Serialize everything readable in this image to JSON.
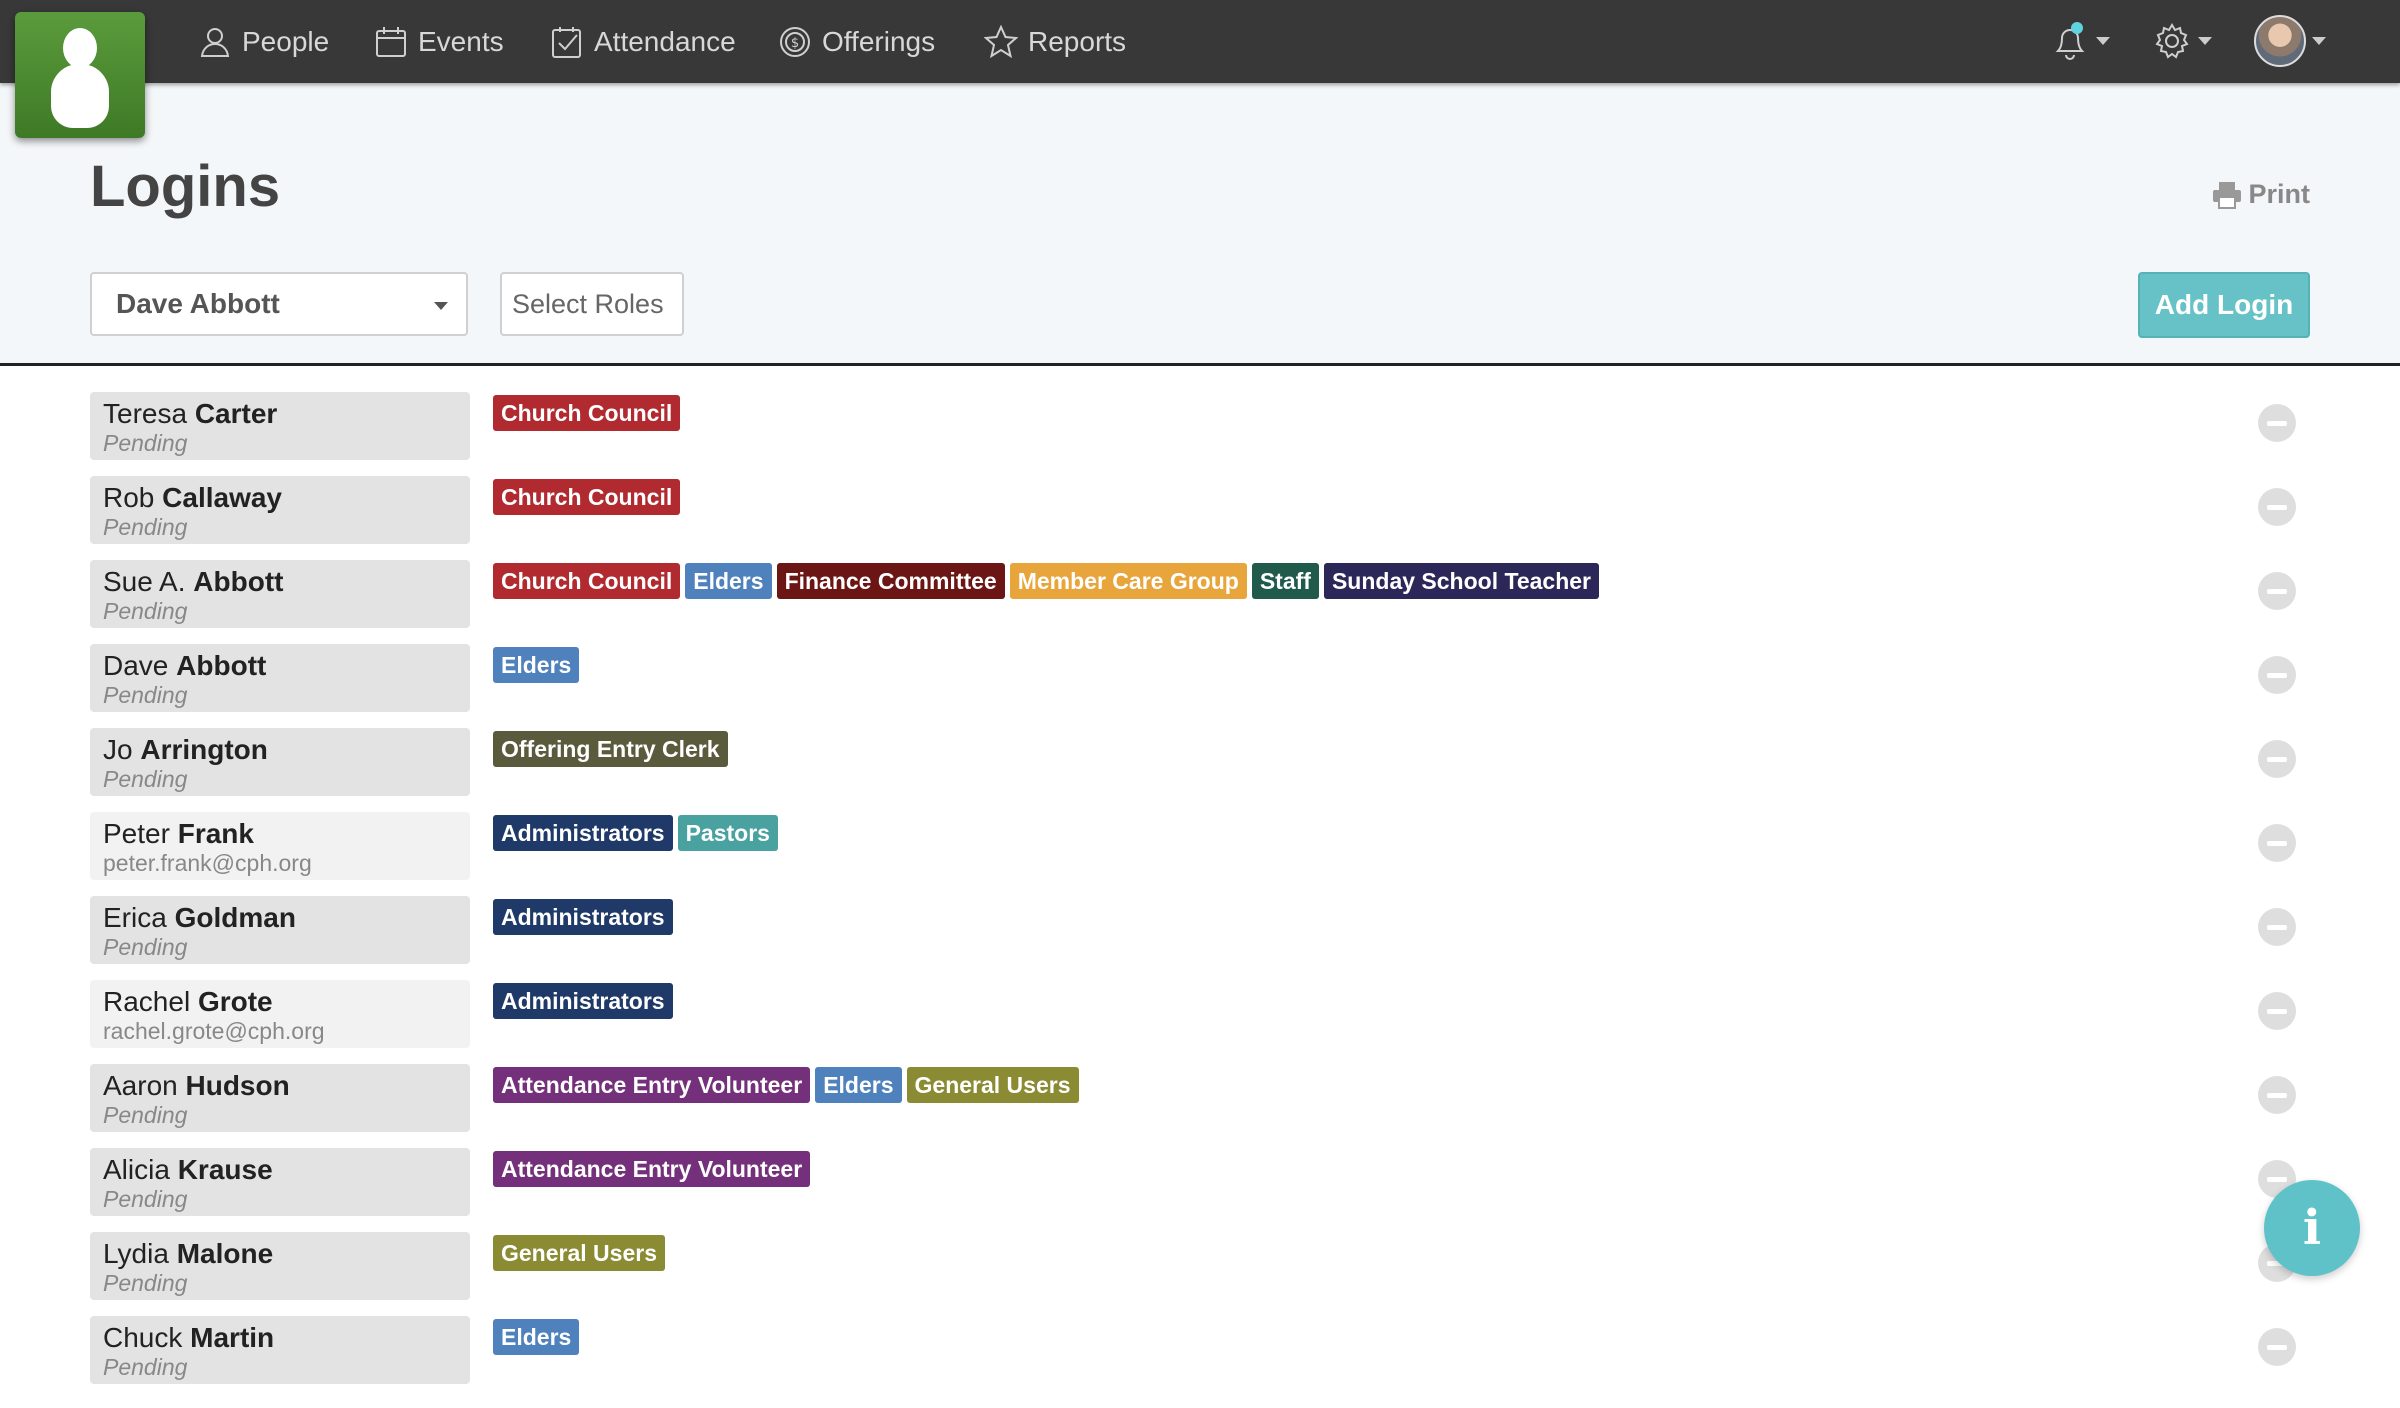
{
  "nav": {
    "items": [
      {
        "label": "People",
        "icon": "person-icon"
      },
      {
        "label": "Events",
        "icon": "calendar-icon"
      },
      {
        "label": "Attendance",
        "icon": "checkbox-icon"
      },
      {
        "label": "Offerings",
        "icon": "coin-icon"
      },
      {
        "label": "Reports",
        "icon": "star-icon"
      }
    ],
    "notification_dot_color": "#5fd3e0"
  },
  "page": {
    "title": "Logins",
    "print_label": "Print",
    "user_select_value": "Dave Abbott",
    "roles_placeholder": "Select Roles",
    "add_login_label": "Add Login",
    "info_label": "i"
  },
  "role_colors": {
    "Church Council": "#b02a30",
    "Elders": "#4f82bd",
    "Finance Committee": "#6b1614",
    "Member Care Group": "#e8a53c",
    "Staff": "#1f5a4a",
    "Sunday School Teacher": "#2b2758",
    "Offering Entry Clerk": "#5a5a3c",
    "Administrators": "#1f3a68",
    "Pastors": "#4aa2a0",
    "Attendance Entry Volunteer": "#74307a",
    "General Users": "#8b8b34"
  },
  "logins": [
    {
      "first": "Teresa",
      "last": "Carter",
      "sub": "Pending",
      "roles": [
        "Church Council"
      ]
    },
    {
      "first": "Rob",
      "last": "Callaway",
      "sub": "Pending",
      "roles": [
        "Church Council"
      ]
    },
    {
      "first": "Sue A.",
      "last": "Abbott",
      "sub": "Pending",
      "roles": [
        "Church Council",
        "Elders",
        "Finance Committee",
        "Member Care Group",
        "Staff",
        "Sunday School Teacher"
      ]
    },
    {
      "first": "Dave",
      "last": "Abbott",
      "sub": "Pending",
      "roles": [
        "Elders"
      ]
    },
    {
      "first": "Jo",
      "last": "Arrington",
      "sub": "Pending",
      "roles": [
        "Offering Entry Clerk"
      ]
    },
    {
      "first": "Peter",
      "last": "Frank",
      "sub": "peter.frank@cph.org",
      "roles": [
        "Administrators",
        "Pastors"
      ]
    },
    {
      "first": "Erica",
      "last": "Goldman",
      "sub": "Pending",
      "roles": [
        "Administrators"
      ]
    },
    {
      "first": "Rachel",
      "last": "Grote",
      "sub": "rachel.grote@cph.org",
      "roles": [
        "Administrators"
      ]
    },
    {
      "first": "Aaron",
      "last": "Hudson",
      "sub": "Pending",
      "roles": [
        "Attendance Entry Volunteer",
        "Elders",
        "General Users"
      ]
    },
    {
      "first": "Alicia",
      "last": "Krause",
      "sub": "Pending",
      "roles": [
        "Attendance Entry Volunteer"
      ]
    },
    {
      "first": "Lydia",
      "last": "Malone",
      "sub": "Pending",
      "roles": [
        "General Users"
      ]
    },
    {
      "first": "Chuck",
      "last": "Martin",
      "sub": "Pending",
      "roles": [
        "Elders"
      ]
    }
  ]
}
